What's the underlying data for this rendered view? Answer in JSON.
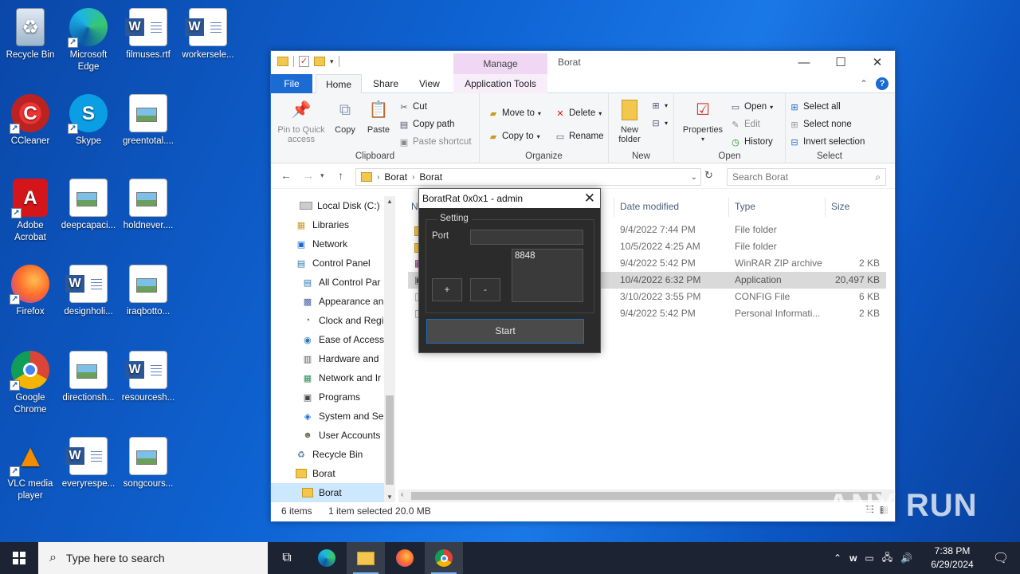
{
  "desktop": {
    "icons": [
      {
        "label": "Recycle Bin"
      },
      {
        "label": "Microsoft Edge"
      },
      {
        "label": "filmuses.rtf"
      },
      {
        "label": "workersele..."
      },
      {
        "label": "CCleaner"
      },
      {
        "label": "Skype"
      },
      {
        "label": "greentotal...."
      },
      {
        "label": "Adobe Acrobat"
      },
      {
        "label": "deepcapaci..."
      },
      {
        "label": "holdnever...."
      },
      {
        "label": "Firefox"
      },
      {
        "label": "designholi..."
      },
      {
        "label": "iraqbotto..."
      },
      {
        "label": "Google Chrome"
      },
      {
        "label": "directionsh..."
      },
      {
        "label": "resourcesh..."
      },
      {
        "label": "VLC media player"
      },
      {
        "label": "everyrespe..."
      },
      {
        "label": "songcours..."
      }
    ]
  },
  "explorer": {
    "title": "Borat",
    "manage_tab": "Manage",
    "tabs": {
      "file": "File",
      "home": "Home",
      "share": "Share",
      "view": "View",
      "app_tools": "Application Tools"
    },
    "ribbon": {
      "clipboard": {
        "label": "Clipboard",
        "pin": "Pin to Quick access",
        "copy": "Copy",
        "paste": "Paste",
        "cut": "Cut",
        "copy_path": "Copy path",
        "paste_shortcut": "Paste shortcut"
      },
      "organize": {
        "label": "Organize",
        "move_to": "Move to",
        "copy_to": "Copy to",
        "delete": "Delete",
        "rename": "Rename"
      },
      "new": {
        "label": "New",
        "new_folder": "New folder"
      },
      "open": {
        "label": "Open",
        "properties": "Properties",
        "open": "Open",
        "edit": "Edit",
        "history": "History"
      },
      "select": {
        "label": "Select",
        "select_all": "Select all",
        "select_none": "Select none",
        "invert": "Invert selection"
      }
    },
    "address": {
      "crumb1": "Borat",
      "crumb2": "Borat"
    },
    "search_placeholder": "Search Borat",
    "nav_items": [
      {
        "label": "Local Disk (C:)",
        "icon": "drive-icon"
      },
      {
        "label": "Libraries",
        "icon": "libraries-icon"
      },
      {
        "label": "Network",
        "icon": "network-icon"
      },
      {
        "label": "Control Panel",
        "icon": "control-panel-icon"
      },
      {
        "label": "All Control Par",
        "icon": "cp-item-icon"
      },
      {
        "label": "Appearance an",
        "icon": "cp-item-icon"
      },
      {
        "label": "Clock and Regi",
        "icon": "cp-item-icon"
      },
      {
        "label": "Ease of Access",
        "icon": "cp-item-icon"
      },
      {
        "label": "Hardware and",
        "icon": "cp-item-icon"
      },
      {
        "label": "Network and Ir",
        "icon": "cp-item-icon"
      },
      {
        "label": "Programs",
        "icon": "cp-item-icon"
      },
      {
        "label": "System and Se",
        "icon": "cp-item-icon"
      },
      {
        "label": "User Accounts",
        "icon": "cp-item-icon"
      },
      {
        "label": "Recycle Bin",
        "icon": "recycle-bin-icon"
      },
      {
        "label": "Borat",
        "icon": "folder-icon"
      },
      {
        "label": "Borat",
        "icon": "folder-icon"
      }
    ],
    "columns": {
      "name": "N",
      "date": "Date modified",
      "type": "Type",
      "size": "Size"
    },
    "files": [
      {
        "date": "9/4/2022 7:44 PM",
        "type": "File folder",
        "size": ""
      },
      {
        "date": "10/5/2022 4:25 AM",
        "type": "File folder",
        "size": ""
      },
      {
        "date": "9/4/2022 5:42 PM",
        "type": "WinRAR ZIP archive",
        "size": "2 KB"
      },
      {
        "date": "10/4/2022 6:32 PM",
        "type": "Application",
        "size": "20,497 KB"
      },
      {
        "date": "3/10/2022 3:55 PM",
        "type": "CONFIG File",
        "size": "6 KB"
      },
      {
        "date": "9/4/2022 5:42 PM",
        "type": "Personal Informati...",
        "size": "2 KB"
      }
    ],
    "status": {
      "items": "6 items",
      "selected": "1 item selected  20.0 MB"
    }
  },
  "boratrat": {
    "title": "BoratRat 0x0x1 - admin",
    "group_label": "Setting",
    "port_label": "Port",
    "port_value": "",
    "ports_list": "8848",
    "add_label": "+",
    "remove_label": "-",
    "start_label": "Start"
  },
  "taskbar": {
    "search_placeholder": "Type here to search",
    "time": "7:38 PM",
    "date": "6/29/2024"
  },
  "watermark": "ANY RUN",
  "colors": {
    "accent": "#1a6bd3",
    "taskbar": "#1c2433",
    "manage": "#f0d8f4"
  }
}
